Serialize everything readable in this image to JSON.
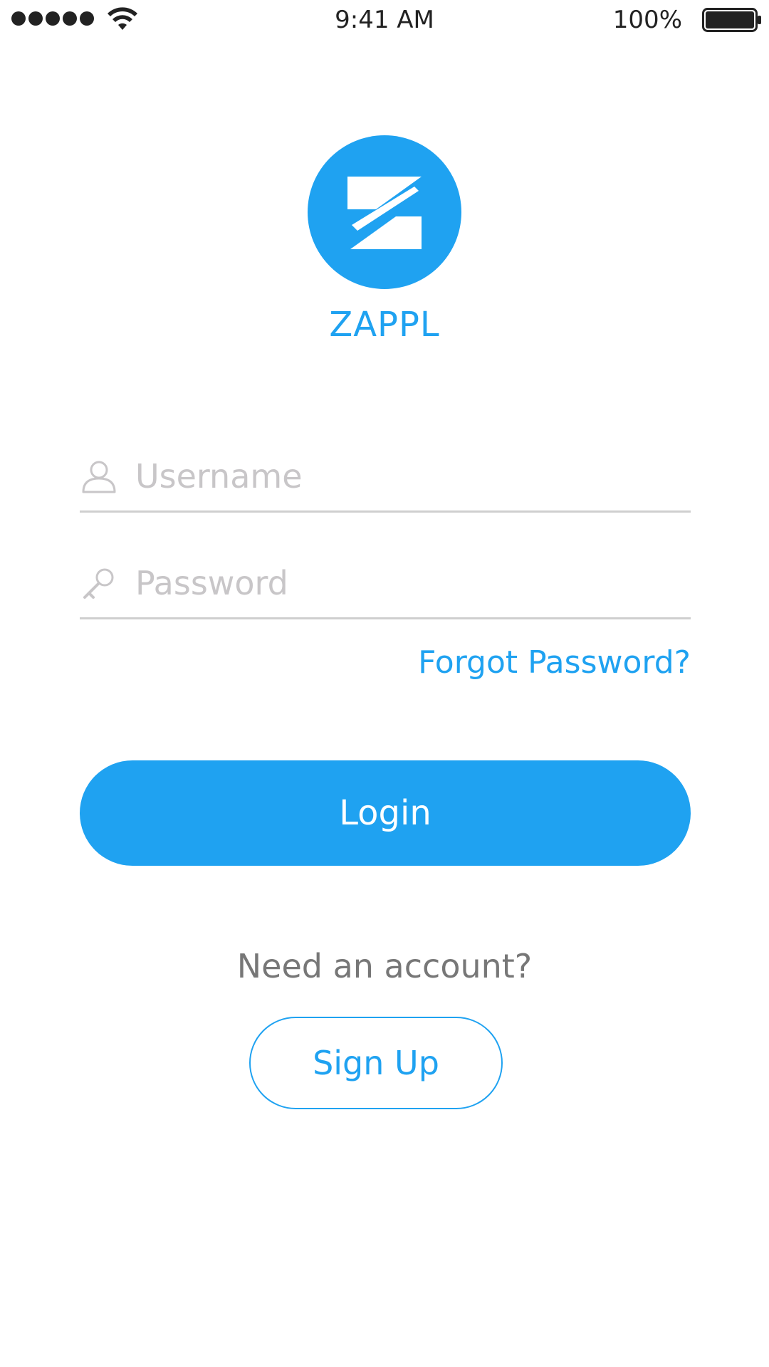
{
  "status_bar": {
    "time": "9:41 AM",
    "battery_percent": "100%",
    "signal_bars": 5,
    "wifi_icon": "wifi-icon",
    "battery_icon": "battery-icon"
  },
  "app": {
    "name": "ZAPPL",
    "logo_icon": "z-logo-icon",
    "brand_color": "#1FA2F1"
  },
  "form": {
    "username": {
      "placeholder": "Username",
      "value": "",
      "icon": "user-icon"
    },
    "password": {
      "placeholder": "Password",
      "value": "",
      "icon": "key-icon"
    },
    "forgot_password": "Forgot Password?",
    "login_label": "Login"
  },
  "signup": {
    "prompt": "Need an account?",
    "button_label": "Sign Up"
  }
}
